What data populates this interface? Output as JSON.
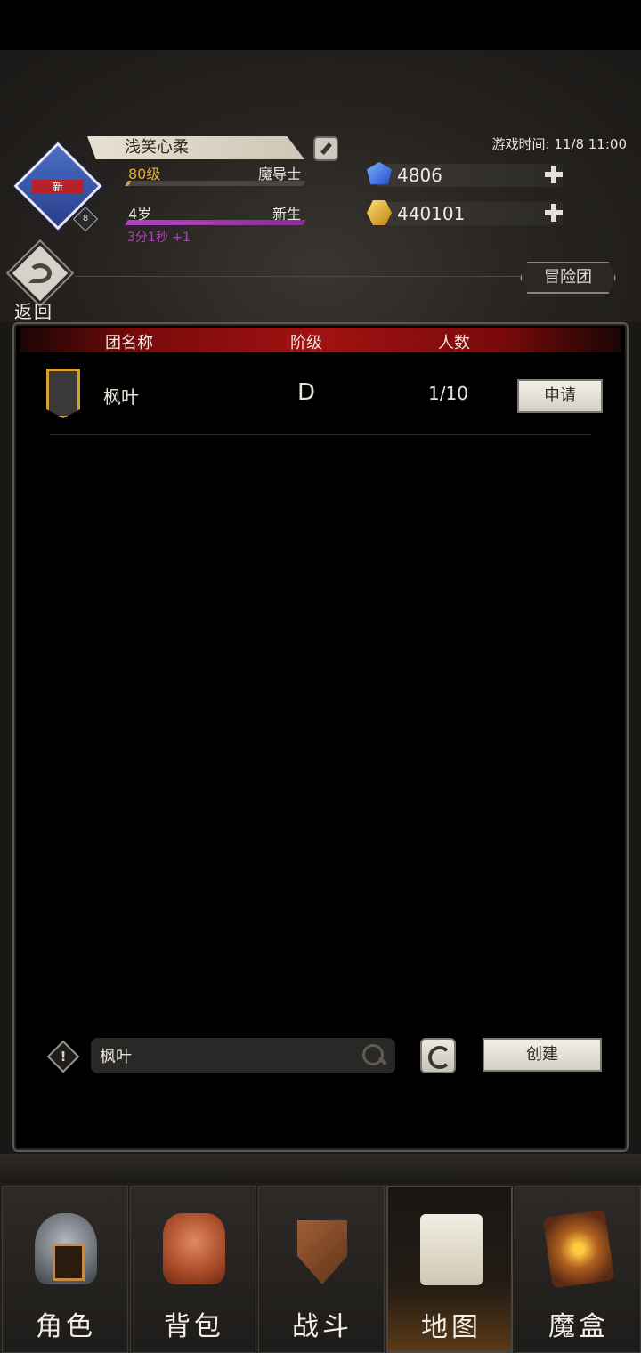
{
  "player": {
    "name": "浅笑心柔",
    "level_text": "80级",
    "class_name": "魔导士",
    "age_text": "4岁",
    "stage_text": "新生",
    "timer_text": "3分1秒 +1",
    "new_badge": "新",
    "badge_number": "8"
  },
  "game_time": "游戏时间: 11/8 11:00",
  "currencies": [
    {
      "name": "gem",
      "icon": "blue-gem-icon",
      "value": "4806"
    },
    {
      "name": "gold",
      "icon": "gold-coin-icon",
      "value": "440101"
    }
  ],
  "back": {
    "label": "返回"
  },
  "section_tag": "冒险团",
  "table": {
    "headers": [
      "团名称",
      "阶级",
      "人数"
    ],
    "rows": [
      {
        "name": "枫叶",
        "rank": "D",
        "count": "1/10",
        "action": "申请"
      }
    ]
  },
  "search": {
    "value": "枫叶",
    "placeholder": ""
  },
  "create_label": "创建",
  "nav": [
    {
      "label": "角色",
      "icon": "helmet-icon",
      "active": false
    },
    {
      "label": "背包",
      "icon": "backpack-icon",
      "active": false
    },
    {
      "label": "战斗",
      "icon": "sword-shield-icon",
      "active": false
    },
    {
      "label": "地图",
      "icon": "scroll-map-icon",
      "active": true
    },
    {
      "label": "魔盒",
      "icon": "magic-box-icon",
      "active": false
    }
  ],
  "colors": {
    "accent_red": "#a01212",
    "level_gold": "#e0b040",
    "timer_purple": "#b040c0"
  }
}
